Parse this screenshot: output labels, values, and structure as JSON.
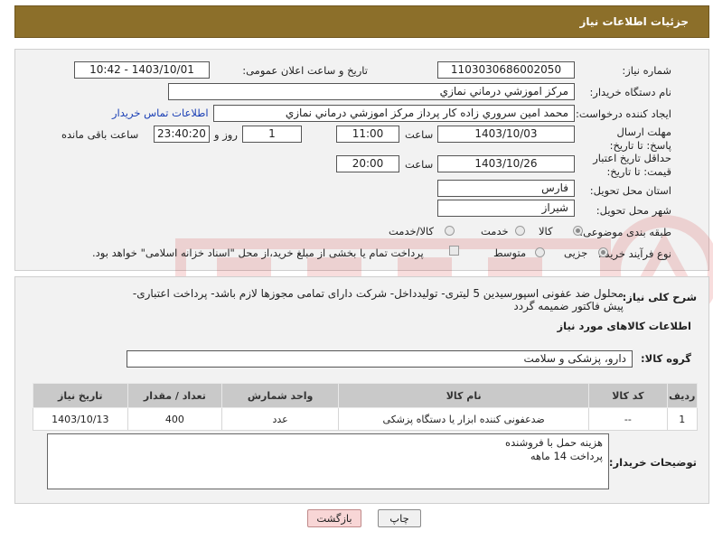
{
  "header": {
    "title": "جزئیات اطلاعات نیاز"
  },
  "form": {
    "need_number_label": "شماره نیاز:",
    "need_number": "1103030686002050",
    "announce_label": "تاریخ و ساعت اعلان عمومی:",
    "announce_value": "1403/10/01 - 10:42",
    "buyer_org_label": "نام دستگاه خریدار:",
    "buyer_org": "مرکز اموزشي درماني نمازي",
    "requester_label": "ایجاد کننده درخواست:",
    "requester": "محمد امين سروري زاده کار پرداز مرکز اموزشي درماني نمازي",
    "buyer_contact_link": "اطلاعات تماس خریدار",
    "reply_deadline_label": "مهلت ارسال پاسخ: تا تاریخ:",
    "reply_date": "1403/10/03",
    "time_label": "ساعت",
    "reply_time": "11:00",
    "days_value": "1",
    "days_label": "روز و",
    "remaining_time": "23:40:20",
    "remaining_label": "ساعت باقی مانده",
    "validity_label": "حداقل تاریخ اعتبار قیمت: تا تاریخ:",
    "validity_date": "1403/10/26",
    "validity_time": "20:00",
    "province_label": "استان محل تحویل:",
    "province": "فارس",
    "city_label": "شهر محل تحویل:",
    "city": "شیراز",
    "category_label": "طبقه بندی موضوعی:",
    "category_options": [
      "کالا",
      "خدمت",
      "کالا/خدمت"
    ],
    "process_label": "نوع فرآیند خرید :",
    "process_options": [
      "جزیی",
      "متوسط"
    ],
    "payment_note": "پرداخت تمام یا بخشی از مبلغ خرید،از محل \"اسناد خزانه اسلامی\" خواهد بود."
  },
  "details": {
    "desc_label": "شرح کلی نیاز:",
    "desc_text": "محلول ضد عفونی اسپورسیدین 5 لیتری- تولیدداخل- شرکت دارای تمامی مجوزها لازم باشد- پرداخت اعتباری- پیش فاکتور ضمیمه گردد",
    "goods_info_title": "اطلاعات کالاهای مورد نیاز",
    "goods_group_label": "گروه کالا:",
    "goods_group": "دارو، پزشکی و سلامت",
    "table": {
      "headers": [
        "ردیف",
        "کد کالا",
        "نام کالا",
        "واحد شمارش",
        "تعداد / مقدار",
        "تاریخ نیاز"
      ],
      "rows": [
        [
          "1",
          "--",
          "ضدعفونی کننده ابزار یا دستگاه پزشکی",
          "عدد",
          "400",
          "1403/10/13"
        ]
      ]
    },
    "buyer_notes_label": "توضیحات خریدار:",
    "buyer_notes_line1": "هزینه حمل با فروشنده",
    "buyer_notes_line2": "پرداخت 14 ماهه"
  },
  "buttons": {
    "print": "چاپ",
    "back": "بازگشت"
  },
  "colors": {
    "header_bg": "#8c6f2a",
    "panel_bg": "#f2f2f2",
    "link": "#1a3fb5",
    "back_btn": "#f8d6d6"
  }
}
